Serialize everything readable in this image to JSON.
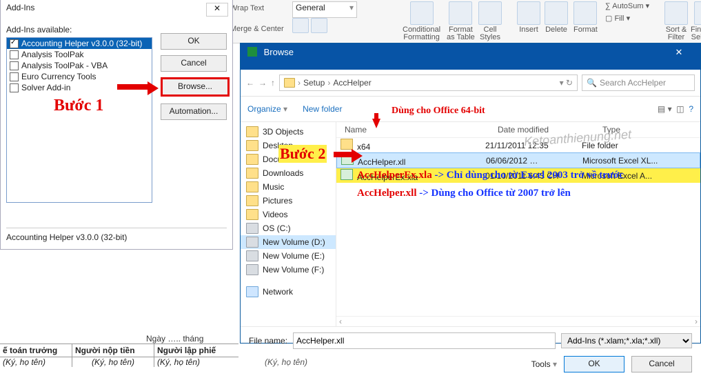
{
  "ribbon": {
    "wrap": "Wrap Text",
    "merge": "Merge & Center",
    "num_fmt": "General",
    "cond": "Conditional\nFormatting",
    "fmt_tbl": "Format\nas Table",
    "cell": "Cell\nStyles",
    "insert": "Insert",
    "delete": "Delete",
    "format": "Format",
    "autosum": "AutoSum",
    "fill": "Fill",
    "sort": "Sort &\nFilter",
    "find": "Find &\nSelect"
  },
  "addin": {
    "title": "Add-Ins",
    "label": "Add-Ins available:",
    "items": [
      {
        "label": "Accounting Helper v3.0.0 (32-bit)",
        "checked": true,
        "selected": true
      },
      {
        "label": "Analysis ToolPak",
        "checked": false
      },
      {
        "label": "Analysis ToolPak - VBA",
        "checked": false
      },
      {
        "label": "Euro Currency Tools",
        "checked": false
      },
      {
        "label": "Solver Add-in",
        "checked": false
      }
    ],
    "ok": "OK",
    "cancel": "Cancel",
    "browse": "Browse...",
    "automation": "Automation...",
    "desc": "Accounting Helper v3.0.0 (32-bit)"
  },
  "browse": {
    "title": "Browse",
    "path": [
      "Setup",
      "AccHelper"
    ],
    "search_ph": "Search AccHelper",
    "organize": "Organize",
    "newfolder": "New folder",
    "tree": [
      {
        "label": "3D Objects",
        "kind": "folder"
      },
      {
        "label": "Desktop",
        "kind": "folder"
      },
      {
        "label": "Documents",
        "kind": "folder"
      },
      {
        "label": "Downloads",
        "kind": "folder"
      },
      {
        "label": "Music",
        "kind": "folder"
      },
      {
        "label": "Pictures",
        "kind": "folder"
      },
      {
        "label": "Videos",
        "kind": "folder"
      },
      {
        "label": "OS (C:)",
        "kind": "drive"
      },
      {
        "label": "New Volume (D:)",
        "kind": "drive",
        "selected": true
      },
      {
        "label": "New Volume (E:)",
        "kind": "drive"
      },
      {
        "label": "New Volume (F:)",
        "kind": "drive"
      },
      {
        "label": "Network",
        "kind": "net"
      }
    ],
    "cols": {
      "name": "Name",
      "date": "Date modified",
      "type": "Type"
    },
    "rows": [
      {
        "name": "x64",
        "date": "21/11/2011 12:35",
        "type": "File folder",
        "kind": "folder"
      },
      {
        "name": "AccHelper.xll",
        "date": "06/06/2012 …",
        "type": "Microsoft Excel XL...",
        "kind": "xl",
        "selected": true
      },
      {
        "name": "AccHelperEx.xla",
        "date": "01/10/2011 6:43 CH",
        "type": "Microsoft Excel A...",
        "kind": "xl",
        "hi": true
      }
    ],
    "fn_label": "File name:",
    "fn_value": "AccHelper.xll",
    "filter": "Add-Ins (*.xlam;*.xla;*.xll)",
    "tools": "Tools",
    "ok": "OK",
    "cancel": "Cancel"
  },
  "ann": {
    "b1": "Bước 1",
    "b2": "Bước 2",
    "x64": "Dùng cho Office 64-bit",
    "l1a": "AccHelperEx.xla",
    "l1b": " -> Chỉ dùng cho từ Excel 2003 trở về trước",
    "l2a": "AccHelper.xll",
    "l2b": " -> Dùng cho Office từ 2007 trở lên",
    "wm": "Ketoanthienung.net"
  },
  "bg": {
    "date": "Ngày ….. tháng",
    "c1": "ế toán trưởng",
    "c2": "Người nộp tiền",
    "c3": "Người lập phiế",
    "sig": "(Ký, họ tên)"
  }
}
